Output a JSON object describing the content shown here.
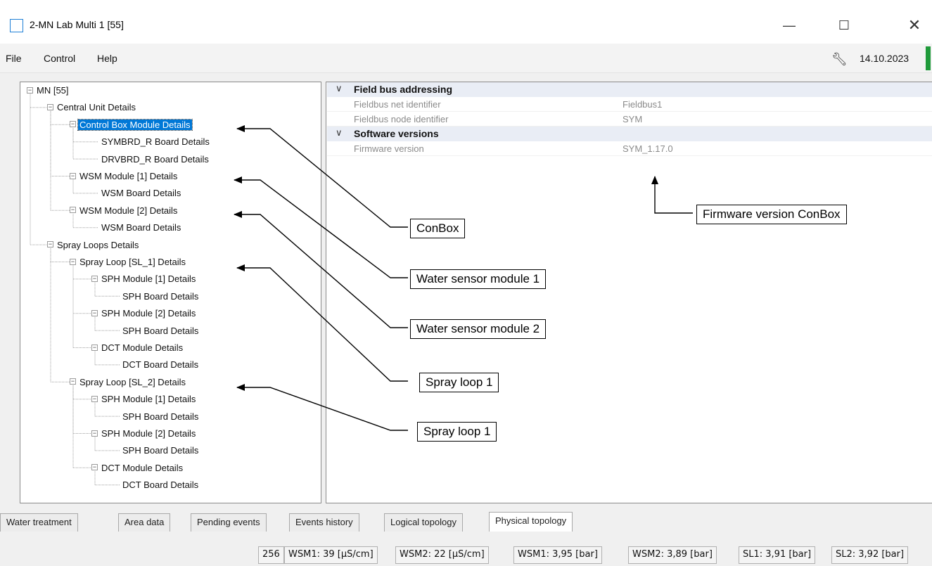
{
  "window": {
    "title": "2-MN Lab Multi 1 [55]",
    "minimize": "—",
    "maximize": "☐",
    "close": "✕"
  },
  "menu": {
    "items": [
      "File",
      "Control",
      "Help"
    ],
    "date": "14.10.2023",
    "tool_icon": "wrench-icon"
  },
  "tree": {
    "nodes": [
      {
        "label": "MN [55]",
        "level": 0,
        "expander": true
      },
      {
        "label": "Central Unit Details",
        "level": 1,
        "expander": true
      },
      {
        "label": "Control Box Module Details",
        "level": 2,
        "expander": true,
        "selected": true
      },
      {
        "label": "SYMBRD_R Board Details",
        "level": 3,
        "expander": false
      },
      {
        "label": "DRVBRD_R Board Details",
        "level": 3,
        "expander": false
      },
      {
        "label": "WSM Module [1] Details",
        "level": 2,
        "expander": true
      },
      {
        "label": "WSM Board Details",
        "level": 3,
        "expander": false
      },
      {
        "label": "WSM Module [2] Details",
        "level": 2,
        "expander": true
      },
      {
        "label": "WSM Board Details",
        "level": 3,
        "expander": false
      },
      {
        "label": "Spray Loops Details",
        "level": 1,
        "expander": true
      },
      {
        "label": "Spray Loop [SL_1] Details",
        "level": 2,
        "expander": true
      },
      {
        "label": "SPH Module [1] Details",
        "level": 3,
        "expander": true
      },
      {
        "label": "SPH Board Details",
        "level": 4,
        "expander": false
      },
      {
        "label": "SPH Module [2] Details",
        "level": 3,
        "expander": true
      },
      {
        "label": "SPH Board Details",
        "level": 4,
        "expander": false
      },
      {
        "label": "DCT Module Details",
        "level": 3,
        "expander": true
      },
      {
        "label": "DCT Board Details",
        "level": 4,
        "expander": false
      },
      {
        "label": "Spray Loop [SL_2] Details",
        "level": 2,
        "expander": true
      },
      {
        "label": "SPH Module [1] Details",
        "level": 3,
        "expander": true
      },
      {
        "label": "SPH Board Details",
        "level": 4,
        "expander": false
      },
      {
        "label": "SPH Module [2] Details",
        "level": 3,
        "expander": true
      },
      {
        "label": "SPH Board Details",
        "level": 4,
        "expander": false
      },
      {
        "label": "DCT Module Details",
        "level": 3,
        "expander": true
      },
      {
        "label": "DCT Board Details",
        "level": 4,
        "expander": false
      }
    ]
  },
  "properties": {
    "categories": [
      {
        "name": "Field bus addressing",
        "rows": [
          {
            "key": "Fieldbus net identifier",
            "value": "Fieldbus1"
          },
          {
            "key": "Fieldbus node identifier",
            "value": "SYM"
          }
        ]
      },
      {
        "name": "Software versions",
        "rows": [
          {
            "key": "Firmware version",
            "value": "SYM_1.17.0"
          }
        ]
      }
    ]
  },
  "callouts": {
    "conbox": "ConBox",
    "wsm1": "Water sensor module 1",
    "wsm2": "Water sensor module 2",
    "sl1": "Spray loop 1",
    "sl2": "Spray loop 1",
    "firmware": "Firmware version ConBox"
  },
  "tabs": [
    {
      "label": "Water treatment",
      "active": false
    },
    {
      "label": "Area data",
      "active": false
    },
    {
      "label": "Pending events",
      "active": false
    },
    {
      "label": "Events history",
      "active": false
    },
    {
      "label": "Logical topology",
      "active": false
    },
    {
      "label": "Physical topology",
      "active": true
    }
  ],
  "status": [
    "256",
    "WSM1: 39 [µS/cm]",
    "WSM2: 22 [µS/cm]",
    "WSM1: 3,95 [bar]",
    "WSM2: 3,89 [bar]",
    "SL1: 3,91 [bar]",
    "SL2: 3,92 [bar]"
  ],
  "colors": {
    "selection": "#0078d7",
    "status_green": "#1f9a3a",
    "category_bg": "#e9edf5"
  }
}
